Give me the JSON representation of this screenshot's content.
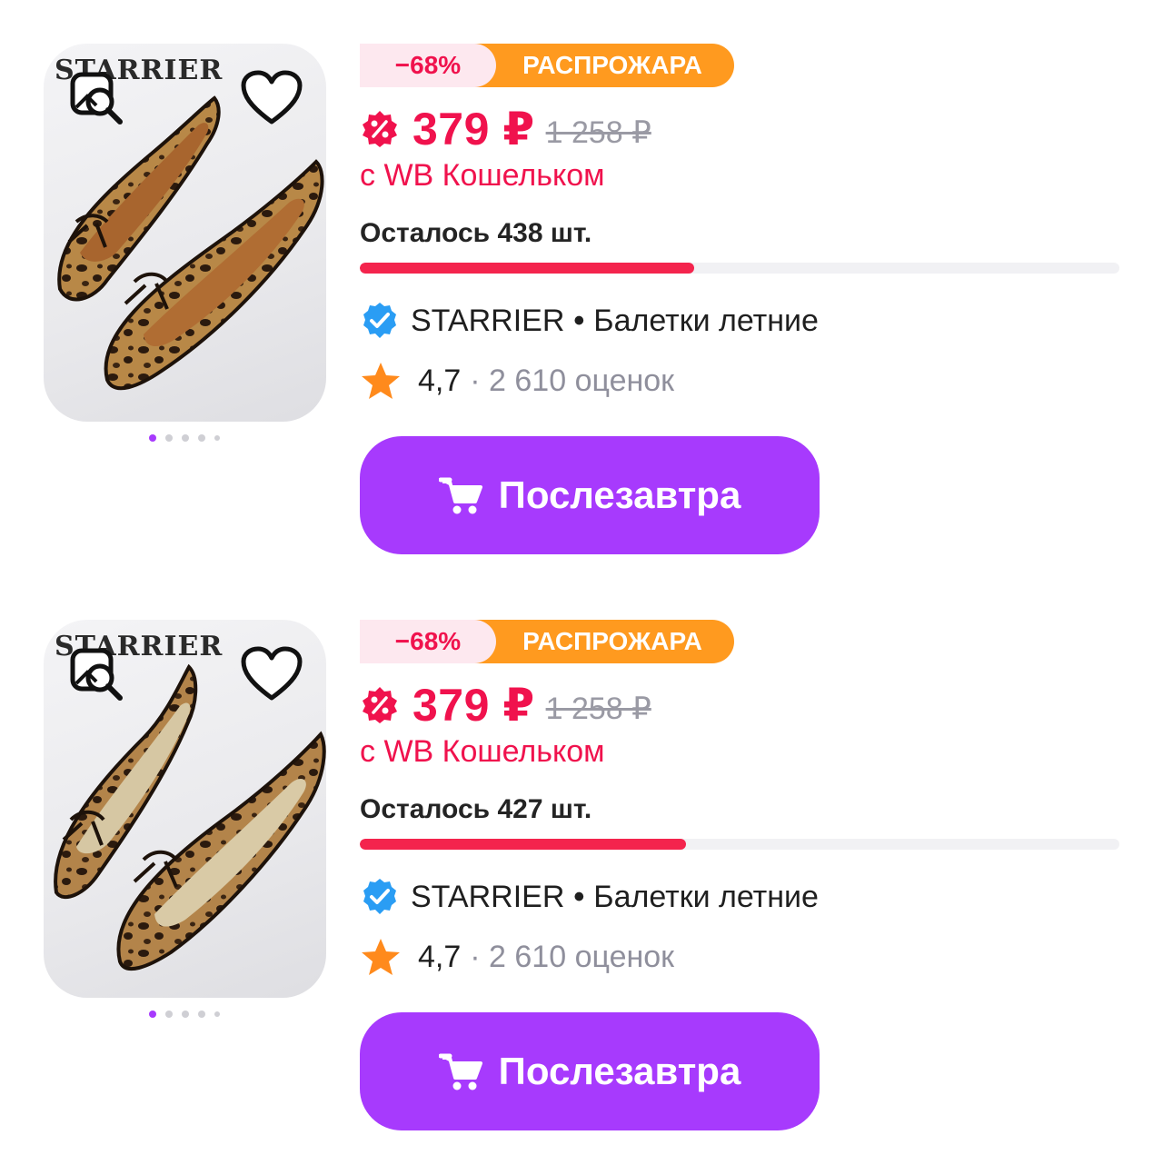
{
  "products": [
    {
      "brand_mark": "STARRIER",
      "discount": "−68%",
      "sale_label": "РАСПРОЖАРА",
      "price": "379 ₽",
      "old_price": "1 258 ₽",
      "wallet_label": "с WB Кошельком",
      "stock_label": "Осталось 438 шт.",
      "stock_fraction": 0.44,
      "seller": "STARRIER",
      "product_name": "Балетки летние",
      "rating": "4,7",
      "reviews": "· 2 610 оценок",
      "buy_label": "Послезавтра",
      "image_dots": 5,
      "active_dot": 0
    },
    {
      "brand_mark": "STARRIER",
      "discount": "−68%",
      "sale_label": "РАСПРОЖАРА",
      "price": "379 ₽",
      "old_price": "1 258 ₽",
      "wallet_label": "с WB Кошельком",
      "stock_label": "Осталось 427 шт.",
      "stock_fraction": 0.43,
      "seller": "STARRIER",
      "product_name": "Балетки летние",
      "rating": "4,7",
      "reviews": "· 2 610 оценок",
      "buy_label": "Послезавтра",
      "image_dots": 5,
      "active_dot": 0
    }
  ],
  "icons": {
    "favorite": "heart-outline-icon",
    "image_search": "image-search-icon",
    "wallet_discount": "wb-discount-icon",
    "verified": "verified-check-icon",
    "rating": "star-icon",
    "cart": "cart-icon"
  },
  "colors": {
    "accent": "#a73afd",
    "price": "#f0124d",
    "sale_badge": "#ff9a1f",
    "discount_bg": "#fde8ef",
    "progress": "#f4244d",
    "verified": "#2a9df4",
    "star": "#ff8a1c"
  }
}
